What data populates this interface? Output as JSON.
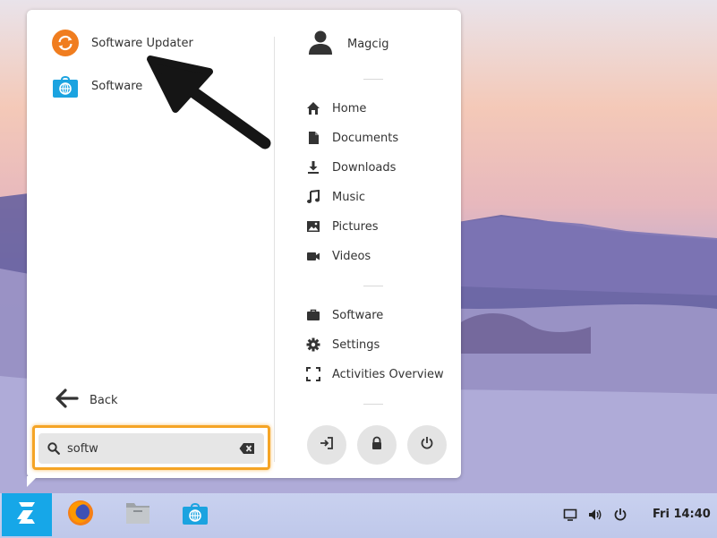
{
  "search_results": [
    {
      "label": "Software Updater",
      "icon": "software-updater-icon"
    },
    {
      "label": "Software",
      "icon": "software-store-icon"
    }
  ],
  "back": {
    "label": "Back",
    "icon": "arrow-left-icon"
  },
  "search": {
    "value": "softw",
    "icon": "search-icon",
    "clear_icon": "backspace-clear-icon"
  },
  "user": {
    "name": "Magcig",
    "icon": "user-avatar-icon"
  },
  "places": [
    {
      "label": "Home",
      "icon": "home-icon"
    },
    {
      "label": "Documents",
      "icon": "document-icon"
    },
    {
      "label": "Downloads",
      "icon": "download-icon"
    },
    {
      "label": "Music",
      "icon": "music-note-icon"
    },
    {
      "label": "Pictures",
      "icon": "picture-icon"
    },
    {
      "label": "Videos",
      "icon": "video-camera-icon"
    }
  ],
  "system": [
    {
      "label": "Software",
      "icon": "briefcase-icon"
    },
    {
      "label": "Settings",
      "icon": "gear-icon"
    },
    {
      "label": "Activities Overview",
      "icon": "activities-frame-icon"
    }
  ],
  "actions": [
    {
      "name": "logout",
      "icon": "logout-icon"
    },
    {
      "name": "lock",
      "icon": "lock-icon"
    },
    {
      "name": "power",
      "icon": "power-icon"
    }
  ],
  "taskbar": {
    "apps": [
      "firefox-icon",
      "files-icon",
      "software-store-icon"
    ],
    "tray": [
      "display-icon",
      "volume-icon",
      "power-icon"
    ],
    "clock": "Fri 14:40"
  },
  "colors": {
    "accent": "#16a7e8",
    "highlight": "#f5a425",
    "updater": "#f07d1f",
    "store": "#1ba3e0"
  }
}
